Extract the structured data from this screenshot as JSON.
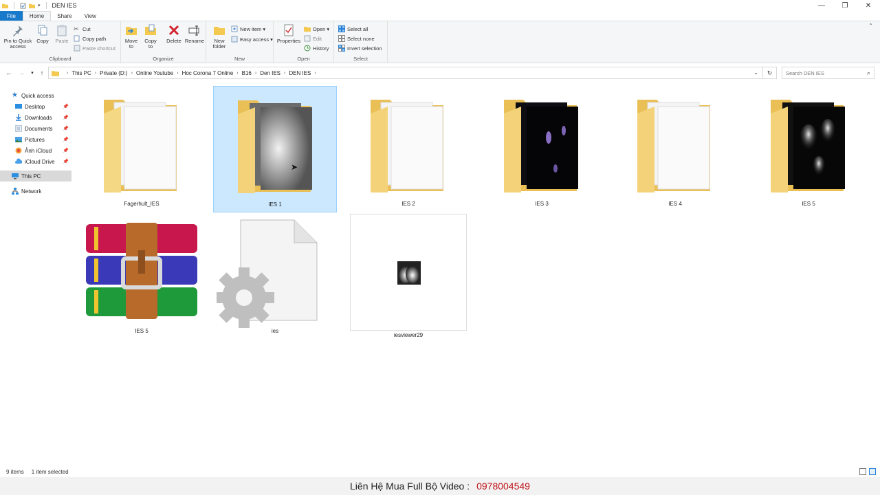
{
  "window": {
    "title": "DEN IES",
    "controls": {
      "minimize": "—",
      "maximize": "❐",
      "close": "✕"
    }
  },
  "ribbon_tabs": [
    {
      "label": "File"
    },
    {
      "label": "Home"
    },
    {
      "label": "Share"
    },
    {
      "label": "View"
    }
  ],
  "ribbon": {
    "clipboard": {
      "label": "Clipboard",
      "pin": "Pin to Quick access",
      "copy": "Copy",
      "paste": "Paste",
      "cut": "Cut",
      "copy_path": "Copy path",
      "paste_shortcut": "Paste shortcut"
    },
    "organize": {
      "label": "Organize",
      "move_to": "Move to",
      "copy_to": "Copy to",
      "delete": "Delete",
      "rename": "Rename"
    },
    "new": {
      "label": "New",
      "new_folder": "New folder",
      "new_item": "New item ▾",
      "easy_access": "Easy access ▾"
    },
    "open": {
      "label": "Open",
      "properties": "Properties",
      "open": "Open ▾",
      "edit": "Edit",
      "history": "History"
    },
    "select": {
      "label": "Select",
      "select_all": "Select all",
      "select_none": "Select none",
      "invert": "Invert selection"
    }
  },
  "address": {
    "crumbs": [
      "This PC",
      "Private (D:)",
      "Online Youtube",
      "Hoc Corona 7 Online",
      "B16",
      "Den IES",
      "DEN IES"
    ],
    "search_placeholder": "Search DEN IES"
  },
  "nav": {
    "quick_access": "Quick access",
    "items": [
      "Desktop",
      "Downloads",
      "Documents",
      "Pictures",
      "Ảnh iCloud",
      "iCloud Drive"
    ],
    "this_pc": "This PC",
    "network": "Network"
  },
  "files": [
    {
      "name": "Fagerhult_IES",
      "kind": "folder",
      "preview": "white"
    },
    {
      "name": "IES 1",
      "kind": "folder",
      "preview": "gray",
      "selected": true
    },
    {
      "name": "IES 2",
      "kind": "folder",
      "preview": "white"
    },
    {
      "name": "IES 3",
      "kind": "folder",
      "preview": "dark-purple"
    },
    {
      "name": "IES 4",
      "kind": "folder",
      "preview": "white"
    },
    {
      "name": "IES 5",
      "kind": "folder",
      "preview": "dark-lights"
    },
    {
      "name": "IES 5",
      "kind": "rar-archive"
    },
    {
      "name": "ies",
      "kind": "config-file"
    },
    {
      "name": "iesviewer29",
      "kind": "application"
    }
  ],
  "status": {
    "count": "9 items",
    "selection": "1 item selected"
  },
  "banner": {
    "text": "Liên Hệ Mua Full Bộ Video :",
    "phone": "0978004549"
  },
  "colors": {
    "accent": "#1979ca",
    "selection": "#cce8ff",
    "folder": "#f3d27a",
    "banner_phone": "#c0141b"
  }
}
